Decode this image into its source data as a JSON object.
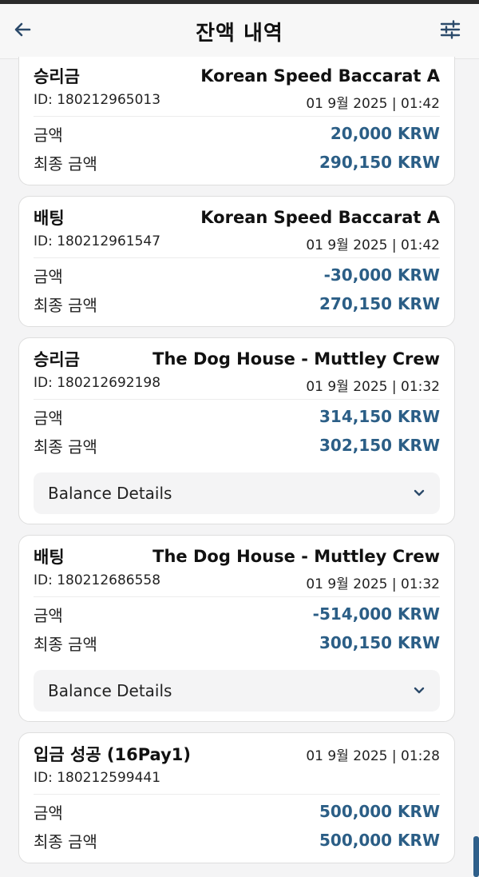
{
  "header": {
    "title": "잔액 내역"
  },
  "cards": [
    {
      "type": "승리금",
      "game": "Korean Speed Baccarat A",
      "id": "ID: 180212965013",
      "datetime": "01 9월 2025 | 01:42",
      "amount_label": "금액",
      "amount": "20,000 KRW",
      "final_label": "최종 금액",
      "final": "290,150 KRW"
    },
    {
      "type": "배팅",
      "game": "Korean Speed Baccarat A",
      "id": "ID: 180212961547",
      "datetime": "01 9월 2025 | 01:42",
      "amount_label": "금액",
      "amount": "-30,000 KRW",
      "final_label": "최종 금액",
      "final": "270,150 KRW"
    },
    {
      "type": "승리금",
      "game": "The Dog House - Muttley Crew",
      "id": "ID: 180212692198",
      "datetime": "01 9월 2025 | 01:32",
      "amount_label": "금액",
      "amount": "314,150 KRW",
      "final_label": "최종 금액",
      "final": "302,150 KRW",
      "details_label": "Balance Details"
    },
    {
      "type": "배팅",
      "game": "The Dog House - Muttley Crew",
      "id": "ID: 180212686558",
      "datetime": "01 9월 2025 | 01:32",
      "amount_label": "금액",
      "amount": "-514,000 KRW",
      "final_label": "최종 금액",
      "final": "300,150 KRW",
      "details_label": "Balance Details"
    },
    {
      "type": "입금 성공 (16Pay1)",
      "datetime": "01 9월 2025 | 01:28",
      "id": "ID: 180212599441",
      "amount_label": "금액",
      "amount": "500,000 KRW",
      "final_label": "최종 금액",
      "final": "500,000 KRW"
    }
  ],
  "colors": {
    "amount": "#2b5e86",
    "background": "#f4f4f5",
    "scrollbar": "#2e5f8a"
  },
  "icons": {
    "back": "arrow-left-icon",
    "filter": "sliders-icon",
    "expand": "chevron-down-icon"
  }
}
